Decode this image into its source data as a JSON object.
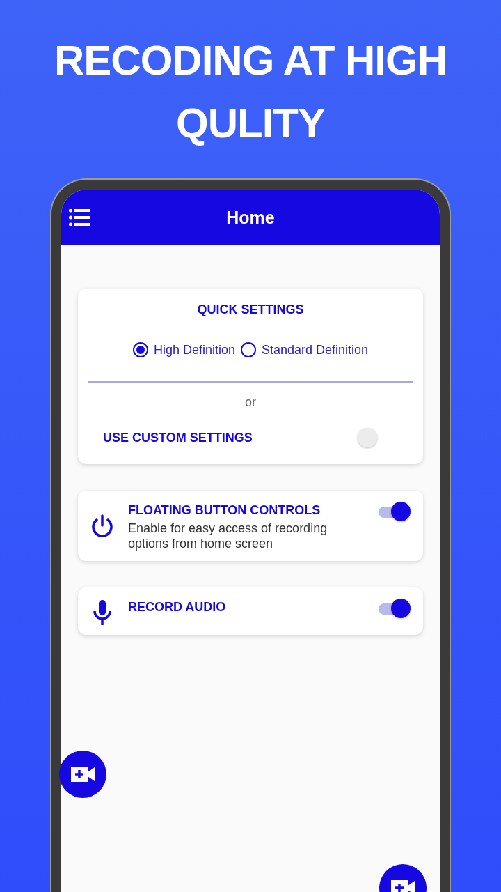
{
  "headline": "RECODING AT HIGH QULITY",
  "app_bar": {
    "title": "Home"
  },
  "quick_settings": {
    "title": "QUICK SETTINGS",
    "options": [
      {
        "label": "High Definition",
        "selected": true
      },
      {
        "label": "Standard Definition",
        "selected": false
      }
    ],
    "separator": "or",
    "custom": {
      "label": "USE CUSTOM SETTINGS",
      "on": false
    }
  },
  "settings": [
    {
      "kind": "power",
      "title": "FLOATING BUTTON CONTROLS",
      "description": "Enable for easy access of recording options from home screen",
      "on": true
    },
    {
      "kind": "mic",
      "title": "RECORD AUDIO",
      "on": true
    }
  ]
}
